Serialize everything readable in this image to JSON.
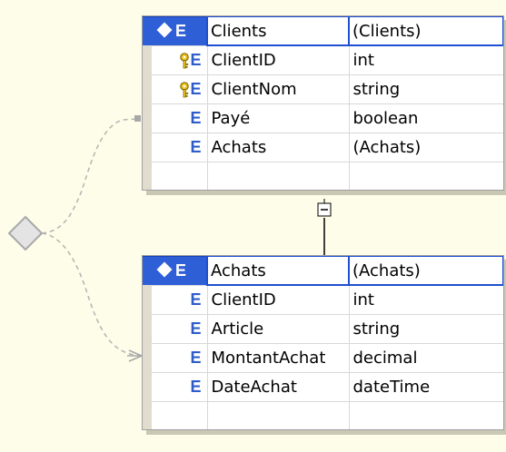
{
  "diagram": {
    "entities": [
      {
        "id": "clients",
        "header": {
          "name": "Clients",
          "type": "(Clients)"
        },
        "fields": [
          {
            "name": "ClientID",
            "type": "int",
            "icon": "key-icon"
          },
          {
            "name": "ClientNom",
            "type": "string",
            "icon": "key-icon"
          },
          {
            "name": "Payé",
            "type": "boolean",
            "icon": "element-icon"
          },
          {
            "name": "Achats",
            "type": "(Achats)",
            "icon": "element-icon"
          }
        ]
      },
      {
        "id": "achats",
        "header": {
          "name": "Achats",
          "type": "(Achats)"
        },
        "fields": [
          {
            "name": "ClientID",
            "type": "int",
            "icon": "element-icon"
          },
          {
            "name": "Article",
            "type": "string",
            "icon": "element-icon"
          },
          {
            "name": "MontantAchat",
            "type": "decimal",
            "icon": "element-icon"
          },
          {
            "name": "DateAchat",
            "type": "dateTime",
            "icon": "element-icon"
          }
        ]
      }
    ],
    "icons": {
      "element": "E",
      "header_marker": "diamond-icon",
      "key": "key-icon",
      "collapse": "collapse-toggle-icon",
      "root": "schema-root-diamond-icon"
    },
    "colors": {
      "background": "#fdfde9",
      "header_blue": "#2f5fd6",
      "element_blue": "#2e5cc9",
      "key_gold": "#d9b21a",
      "connector_gray": "#a8a8a8"
    }
  }
}
